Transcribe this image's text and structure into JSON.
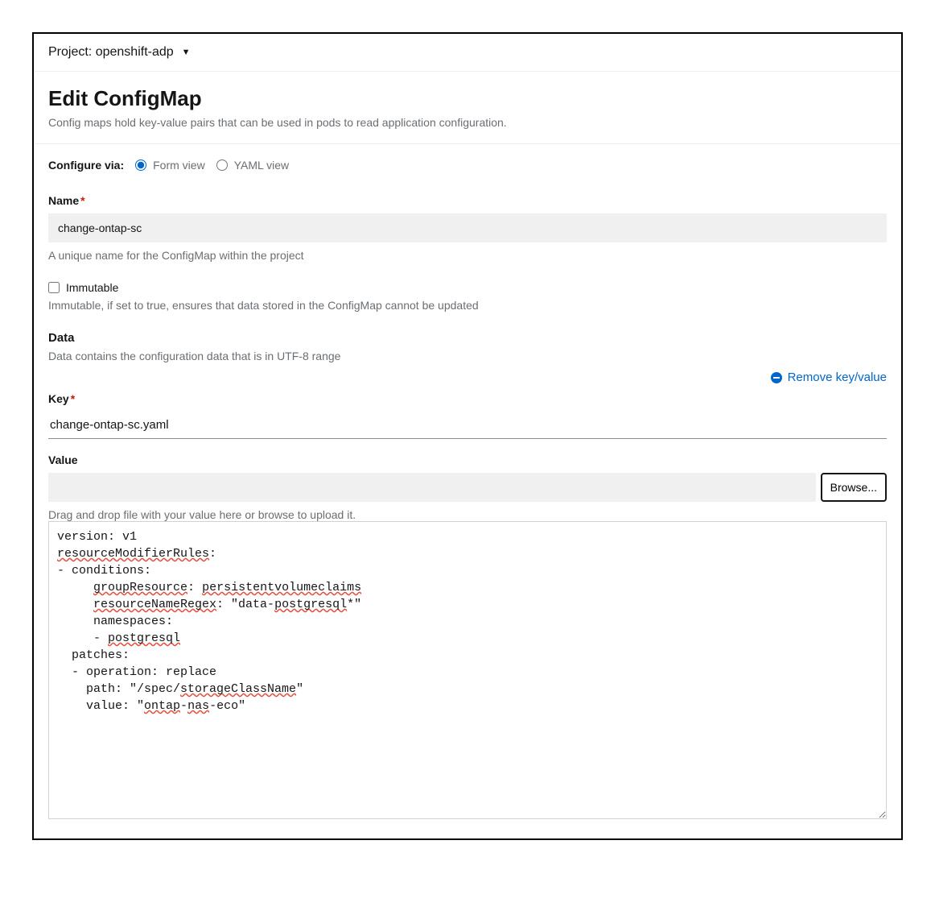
{
  "project": {
    "prefix": "Project:",
    "name": "openshift-adp"
  },
  "page": {
    "title": "Edit ConfigMap",
    "description": "Config maps hold key-value pairs that can be used in pods to read application configuration."
  },
  "configure": {
    "label": "Configure via:",
    "options": {
      "form": "Form view",
      "yaml": "YAML view"
    },
    "selected": "form"
  },
  "name_field": {
    "label": "Name",
    "value": "change-ontap-sc",
    "helper": "A unique name for the ConfigMap within the project"
  },
  "immutable": {
    "label": "Immutable",
    "checked": false,
    "helper": "Immutable, if set to true, ensures that data stored in the ConfigMap cannot be updated"
  },
  "data_section": {
    "label": "Data",
    "helper": "Data contains the configuration data that is in UTF-8 range",
    "remove_label": "Remove key/value"
  },
  "key_field": {
    "label": "Key",
    "value": "change-ontap-sc.yaml"
  },
  "value_field": {
    "label": "Value",
    "browse": "Browse...",
    "drop_helper": "Drag and drop file with your value here or browse to upload it.",
    "content": "version: v1\nresourceModifierRules:\n- conditions:\n     groupResource: persistentvolumeclaims\n     resourceNameRegex: \"data-postgresql*\"\n     namespaces:\n     - postgresql\n  patches:\n  - operation: replace\n    path: \"/spec/storageClassName\"\n    value: \"ontap-nas-eco\""
  }
}
